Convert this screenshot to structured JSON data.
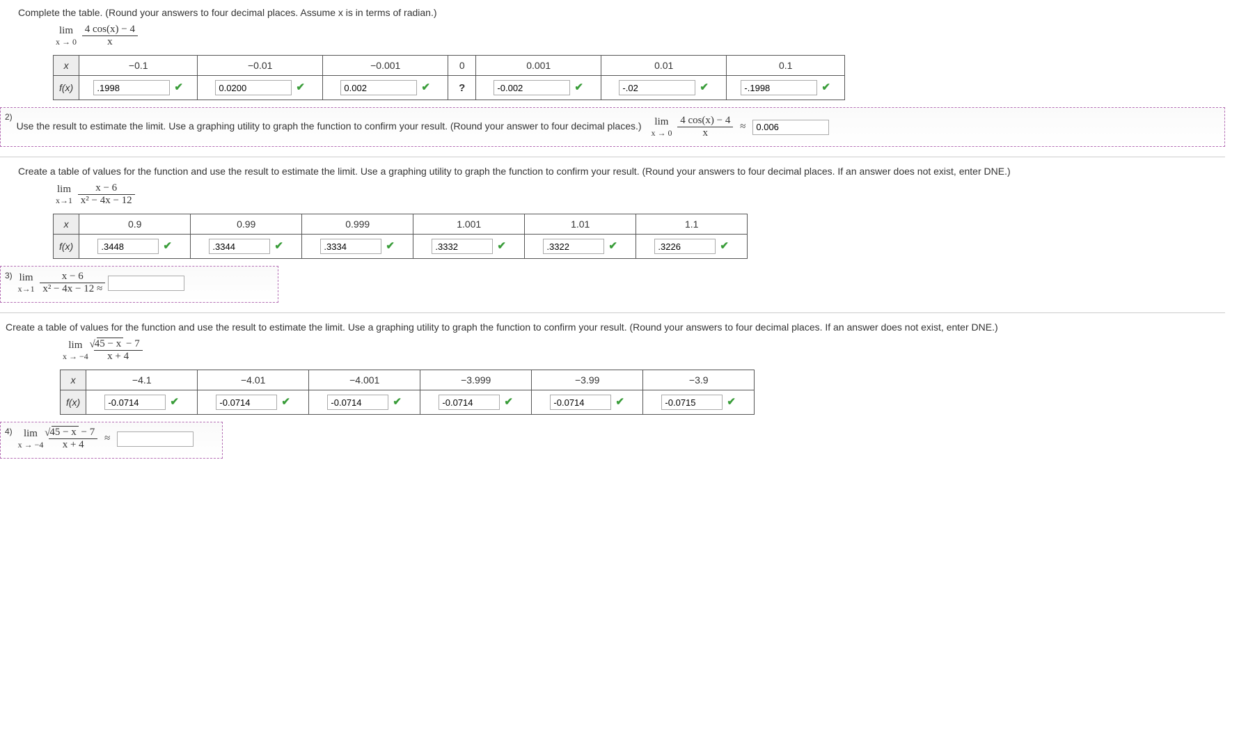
{
  "q1": {
    "prompt": "Complete the table. (Round your answers to four decimal places. Assume x is in terms of radian.)",
    "lim_top": "lim",
    "lim_bot": "x → 0",
    "frac_num": "4 cos(x) − 4",
    "frac_den": "x",
    "x_label": "x",
    "fx_label": "f(x)",
    "xvals": [
      "−0.1",
      "−0.01",
      "−0.001",
      "0",
      "0.001",
      "0.01",
      "0.1"
    ],
    "center": "?",
    "fx": [
      ".1998",
      "0.0200",
      "0.002",
      "-0.002",
      "-.02",
      "-.1998"
    ]
  },
  "q2": {
    "num": "2)",
    "prompt": "Use the result to estimate the limit. Use a graphing utility to graph the function to confirm your result. (Round your answer to four decimal places.)",
    "lim_top": "lim",
    "lim_bot": "x → 0",
    "frac_num": "4 cos(x) − 4",
    "frac_den": "x",
    "approx": "≈",
    "ans": "0.006"
  },
  "q3intro": {
    "prompt": "Create a table of values for the function and use the result to estimate the limit. Use a graphing utility to graph the function to confirm your result. (Round your answers to four decimal places. If an answer does not exist, enter DNE.)",
    "lim_top": "lim",
    "lim_bot": "x→1",
    "frac_num": "x − 6",
    "frac_den": "x² − 4x − 12",
    "x_label": "x",
    "fx_label": "f(x)",
    "xvals": [
      "0.9",
      "0.99",
      "0.999",
      "1.001",
      "1.01",
      "1.1"
    ],
    "fx": [
      ".3448",
      ".3344",
      ".3334",
      ".3332",
      ".3322",
      ".3226"
    ]
  },
  "q3": {
    "num": "3)",
    "lim_top": "lim",
    "lim_bot": "x→1",
    "frac_num": "x − 6",
    "frac_den": "x² − 4x − 12",
    "approx": "≈",
    "ans": ""
  },
  "q4intro": {
    "prompt": "Create a table of values for the function and use the result to estimate the limit. Use a graphing utility to graph the function to confirm your result. (Round your answers to four decimal places. If an answer does not exist, enter DNE.)",
    "lim_top": "lim",
    "lim_bot": "x → −4",
    "sqrt_inner": "45 − x",
    "sqrt_tail": " − 7",
    "frac_den": "x + 4",
    "x_label": "x",
    "fx_label": "f(x)",
    "xvals": [
      "−4.1",
      "−4.01",
      "−4.001",
      "−3.999",
      "−3.99",
      "−3.9"
    ],
    "fx": [
      "-0.0714",
      "-0.0714",
      "-0.0714",
      "-0.0714",
      "-0.0714",
      "-0.0715"
    ]
  },
  "q4": {
    "num": "4)",
    "lim_top": "lim",
    "lim_bot": "x → −4",
    "sqrt_inner": "45 − x",
    "sqrt_tail": " − 7",
    "frac_den": "x + 4",
    "approx": "≈",
    "ans": ""
  }
}
